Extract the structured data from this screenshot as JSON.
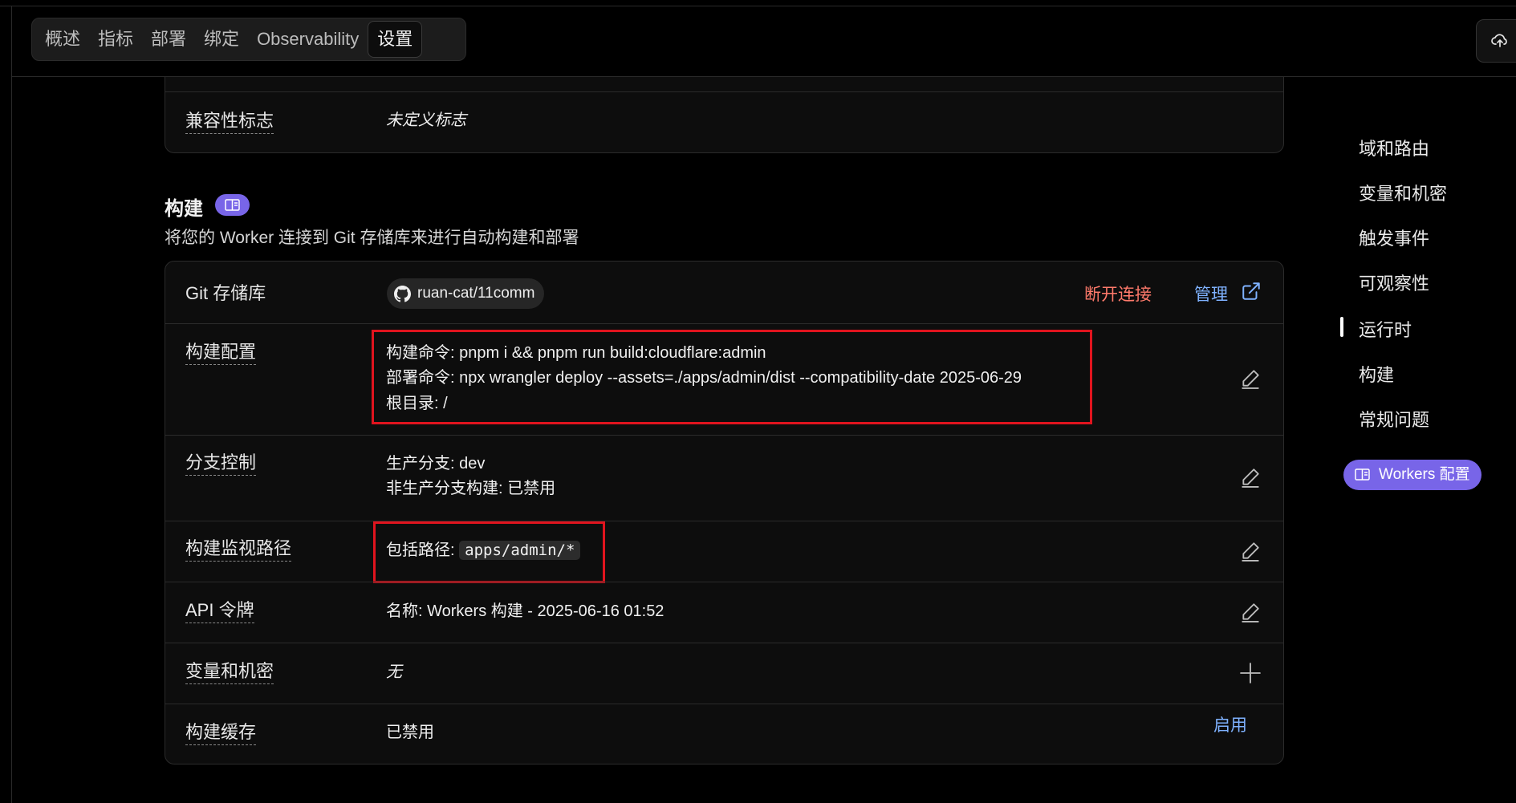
{
  "tabs": [
    {
      "label": "概述"
    },
    {
      "label": "指标"
    },
    {
      "label": "部署"
    },
    {
      "label": "绑定"
    },
    {
      "label": "Observability"
    },
    {
      "label": "设置",
      "active": true
    }
  ],
  "compat": {
    "label": "兼容性标志",
    "value": "未定义标志"
  },
  "build": {
    "title": "构建",
    "subtitle": "将您的 Worker 连接到 Git 存储库来进行自动构建和部署",
    "git": {
      "label": "Git 存储库",
      "repo": "ruan-cat/11comm",
      "disconnect": "断开连接",
      "manage": "管理"
    },
    "config": {
      "label": "构建配置",
      "build_cmd": "构建命令: pnpm i && pnpm run build:cloudflare:admin",
      "deploy_cmd": "部署命令: npx wrangler deploy --assets=./apps/admin/dist --compatibility-date 2025-06-29",
      "root_dir": "根目录: /"
    },
    "branch": {
      "label": "分支控制",
      "production": "生产分支: dev",
      "non_production": "非生产分支构建: 已禁用"
    },
    "watch": {
      "label": "构建监视路径",
      "include_prefix": "包括路径:",
      "path": "apps/admin/*"
    },
    "api_token": {
      "label": "API 令牌",
      "value": "名称: Workers 构建 - 2025-06-16 01:52"
    },
    "vars": {
      "label": "变量和机密",
      "value": "无"
    },
    "cache": {
      "label": "构建缓存",
      "value": "已禁用",
      "action": "启用"
    }
  },
  "side_nav": {
    "items": [
      "域和路由",
      "变量和机密",
      "触发事件",
      "可观察性",
      "运行时",
      "构建",
      "常规问题"
    ],
    "active_index": 4,
    "doc_button": "Workers 配置"
  },
  "colors": {
    "accent": "#7865e8",
    "danger": "#ff7a6b",
    "link": "#7fb2ff",
    "highlight_box": "#e0141e"
  },
  "icons": {
    "upload": "cloud-upload-icon",
    "doc": "book-icon",
    "repo": "github-icon",
    "external": "external-link-icon",
    "edit": "pencil-icon",
    "add": "plus-icon"
  }
}
